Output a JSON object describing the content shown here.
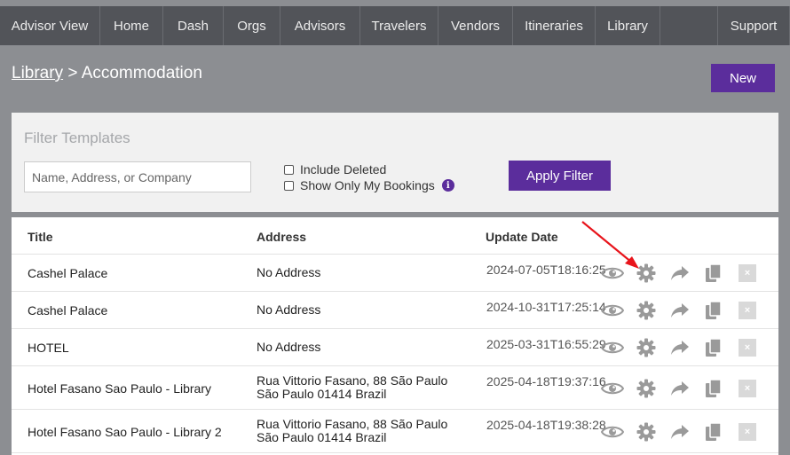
{
  "nav": {
    "items": [
      {
        "label": "Advisor View",
        "name": "nav-advisor-view"
      },
      {
        "label": "Home",
        "name": "nav-home"
      },
      {
        "label": "Dash",
        "name": "nav-dash"
      },
      {
        "label": "Orgs",
        "name": "nav-orgs"
      },
      {
        "label": "Advisors",
        "name": "nav-advisors"
      },
      {
        "label": "Travelers",
        "name": "nav-travelers"
      },
      {
        "label": "Vendors",
        "name": "nav-vendors"
      },
      {
        "label": "Itineraries",
        "name": "nav-itineraries"
      },
      {
        "label": "Library",
        "name": "nav-library"
      }
    ],
    "support": "Support"
  },
  "header": {
    "breadcrumb_link": "Library",
    "breadcrumb_sep": " > ",
    "breadcrumb_current": "Accommodation",
    "new_label": "New"
  },
  "filter": {
    "title": "Filter Templates",
    "placeholder": "Name, Address, or Company",
    "value": "",
    "include_deleted": "Include Deleted",
    "only_mine": "Show Only My Bookings",
    "info_icon": "i",
    "apply_label": "Apply Filter"
  },
  "table": {
    "columns": {
      "title": "Title",
      "address": "Address",
      "date": "Update Date"
    },
    "rows": [
      {
        "title": "Cashel Palace",
        "address": [
          "No Address"
        ],
        "date": "2024-07-05T18:16:25"
      },
      {
        "title": "Cashel Palace",
        "address": [
          "No Address"
        ],
        "date": "2024-10-31T17:25:14"
      },
      {
        "title": "HOTEL",
        "address": [
          "No Address"
        ],
        "date": "2025-03-31T16:55:29"
      },
      {
        "title": "Hotel Fasano Sao Paulo - Library",
        "address": [
          "Rua Vittorio Fasano, 88 São Paulo",
          "São Paulo 01414 Brazil"
        ],
        "date": "2025-04-18T19:37:16"
      },
      {
        "title": "Hotel Fasano Sao Paulo - Library 2",
        "address": [
          "Rua Vittorio Fasano, 88 São Paulo",
          "São Paulo 01414 Brazil"
        ],
        "date": "2025-04-18T19:38:28"
      }
    ],
    "row_actions": [
      "eye-icon",
      "gear-icon",
      "share-icon",
      "copy-icon",
      "close-icon"
    ],
    "close_glyph": "×"
  },
  "colors": {
    "accent": "#5b2d9c",
    "nav_bg": "#525459",
    "page_bg": "#8c8e92",
    "icon": "#9a9a9a",
    "arrow": "#e8141b"
  }
}
